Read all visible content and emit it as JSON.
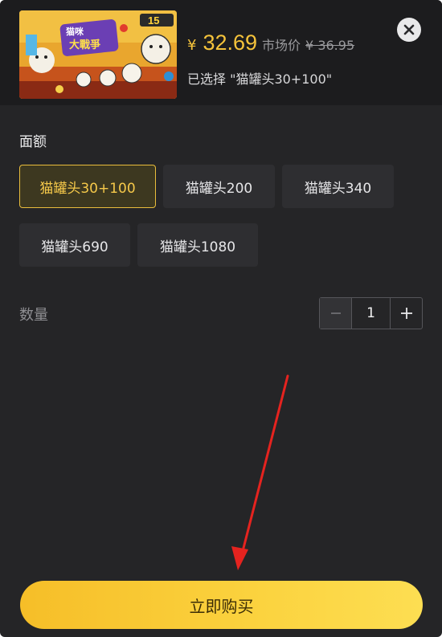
{
  "product": {
    "image_title": "猫咪大戰爭",
    "badge": "15",
    "currency": "¥",
    "price": "32.69",
    "market_label": "市场价",
    "market_price": "¥ 36.95",
    "selected_text": "已选择 \"猫罐头30+100\""
  },
  "denomination": {
    "label": "面额",
    "options": [
      {
        "label": "猫罐头30+100",
        "selected": true
      },
      {
        "label": "猫罐头200",
        "selected": false
      },
      {
        "label": "猫罐头340",
        "selected": false
      },
      {
        "label": "猫罐头690",
        "selected": false
      },
      {
        "label": "猫罐头1080",
        "selected": false
      }
    ]
  },
  "quantity": {
    "label": "数量",
    "value": "1"
  },
  "buy_button": {
    "label": "立即购买"
  },
  "colors": {
    "accent": "#f5c33b",
    "panel_bg": "#252527",
    "header_bg": "#1c1c1e",
    "annotation_arrow": "#e5231f"
  },
  "icons": {
    "close": "close-icon",
    "minus": "minus-icon",
    "plus": "plus-icon"
  }
}
